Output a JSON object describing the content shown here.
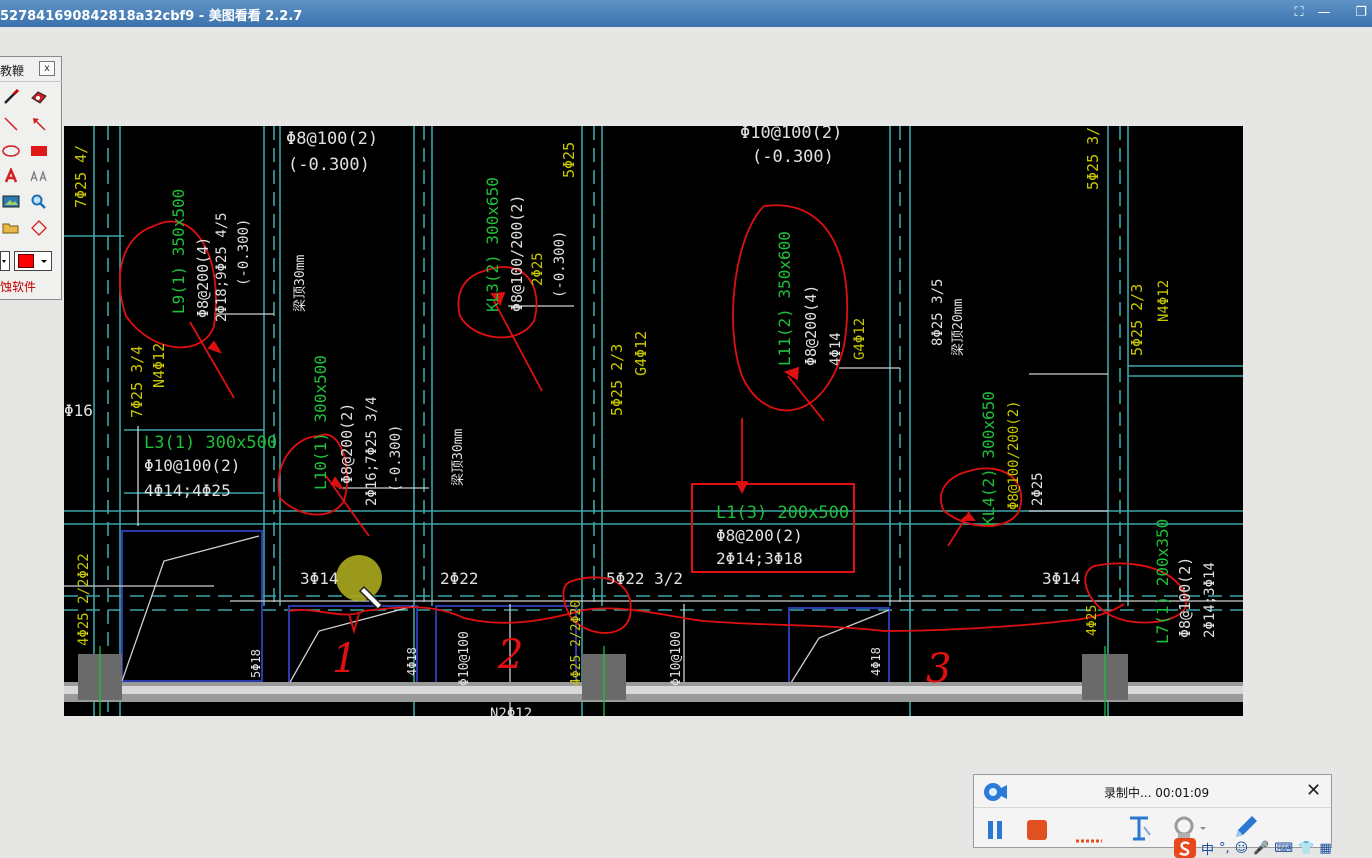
{
  "window": {
    "title": "527841690842818a32cbf9 - 美图看看 2.2.7",
    "controls": [
      "⛶",
      "—",
      "❐"
    ]
  },
  "palette": {
    "title": "教鞭",
    "close_label": "x",
    "brand": "蚀软件",
    "selected_color": "#ff0000"
  },
  "drawing": {
    "annotation_color": "#e01010",
    "labels": [
      "Φ8@100(2)",
      "(-0.300)",
      "Φ10@100(2)",
      "(-0.300)",
      "7Φ25 4/",
      "5Φ25",
      "5Φ25 3/",
      "L9(1) 350x500",
      "Φ8@200(4)",
      "2Φ18;9Φ25 4/5",
      "(-0.300)",
      "7Φ25 3/4",
      "N4Φ12",
      "KL3(2) 300x650",
      "Φ8@100/200(2)",
      "2Φ25",
      "(-0.300)",
      "L11(2) 350x600",
      "Φ8@200(4)",
      "4Φ14",
      "G4Φ12",
      "5Φ25 2/3",
      "G4Φ12",
      "8Φ25 3/5",
      "梁顶20mm",
      "梁顶30mm",
      "5Φ25 2/3",
      "N4Φ12",
      "L3(1) 300x500",
      "Φ10@100(2)",
      "4Φ14;4Φ25",
      "L10(1) 300x500",
      "Φ8@200(2)",
      "2Φ16;7Φ25 3/4",
      "(-0.300)",
      "梁顶30mm",
      "KL4(2) 300x650",
      "Φ8@100/200(2)",
      "2Φ25",
      "L1(3) 200x500",
      "Φ8@200(2)",
      "2Φ14;3Φ18",
      "3Φ14",
      "2Φ22",
      "5Φ22 3/2",
      "3Φ14",
      "L7(1) 200x350",
      "Φ8@100(2)",
      "2Φ14;3Φ14",
      "4Φ25 2/2Φ22",
      "5Φ18",
      "4Φ18",
      "Φ10@100",
      "4Φ25 2/2Φ20",
      "Φ10@100",
      "4Φ18",
      "4Φ25",
      "N2Φ12",
      "Φ16"
    ],
    "handwritten": [
      "1",
      "2",
      "3"
    ]
  },
  "recorder": {
    "status": "录制中... 00:01:09",
    "close_label": "✕"
  },
  "ime": {
    "items": [
      "中",
      "°,",
      "☺",
      "🎤",
      "⌨",
      "👕",
      "▦"
    ]
  }
}
